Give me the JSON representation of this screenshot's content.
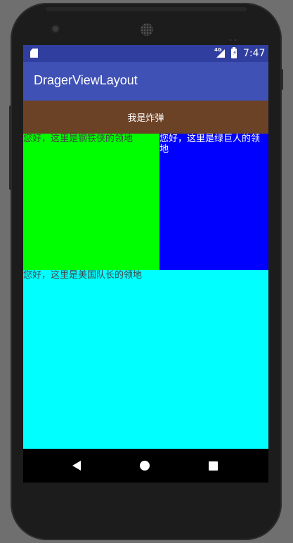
{
  "statusbar": {
    "time": "7:47",
    "network": "4G",
    "icons": [
      "sd-card-icon",
      "signal-icon",
      "battery-icon"
    ]
  },
  "appbar": {
    "title": "DragerViewLayout"
  },
  "bomb": {
    "label": "我是炸弹"
  },
  "regions": {
    "iron_man": "您好，这里是钢铁侠的领地",
    "hulk": "您好，这里是绿巨人的领地",
    "captain": "您好，这里是美国队长的领地"
  },
  "colors": {
    "statusbar": "#303f9f",
    "appbar": "#3f51b5",
    "bomb": "#6b4226",
    "iron_man_region": "#00ff00",
    "hulk_region": "#0000ff",
    "captain_region": "#00ffff"
  },
  "navbar": {
    "icons": [
      "back-icon",
      "home-icon",
      "recents-icon"
    ]
  }
}
